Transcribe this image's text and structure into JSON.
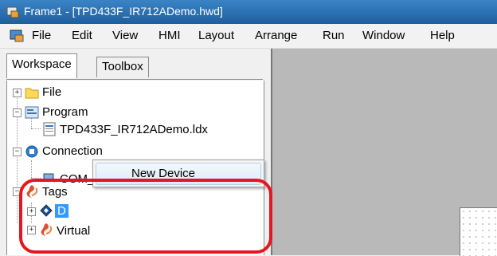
{
  "window": {
    "title": "Frame1 - [TPD433F_IR712ADemo.hwd]"
  },
  "menu": [
    "File",
    "Edit",
    "View",
    "HMI",
    "Layout",
    "Arrange",
    "Run",
    "Window",
    "Help"
  ],
  "tabs": {
    "workspace": "Workspace",
    "toolbox": "Toolbox"
  },
  "tree": {
    "file": "File",
    "program": "Program",
    "program_file": "TPD433F_IR712ADemo.ldx",
    "connection": "Connection",
    "com": "COM_1",
    "tags": "Tags",
    "device": "D",
    "virtual": "Virtual"
  },
  "context_menu": {
    "new_device": "New Device"
  },
  "icons": [
    "app-icon",
    "mdi-doc-icon",
    "folder-icon",
    "program-icon",
    "program-file-icon",
    "connection-icon",
    "com-port-icon",
    "tags-icon",
    "device-icon",
    "virtual-icon"
  ],
  "colors": {
    "titlebar": "#2b72b6",
    "selection": "#3399ff",
    "highlight": "#e8151e"
  }
}
